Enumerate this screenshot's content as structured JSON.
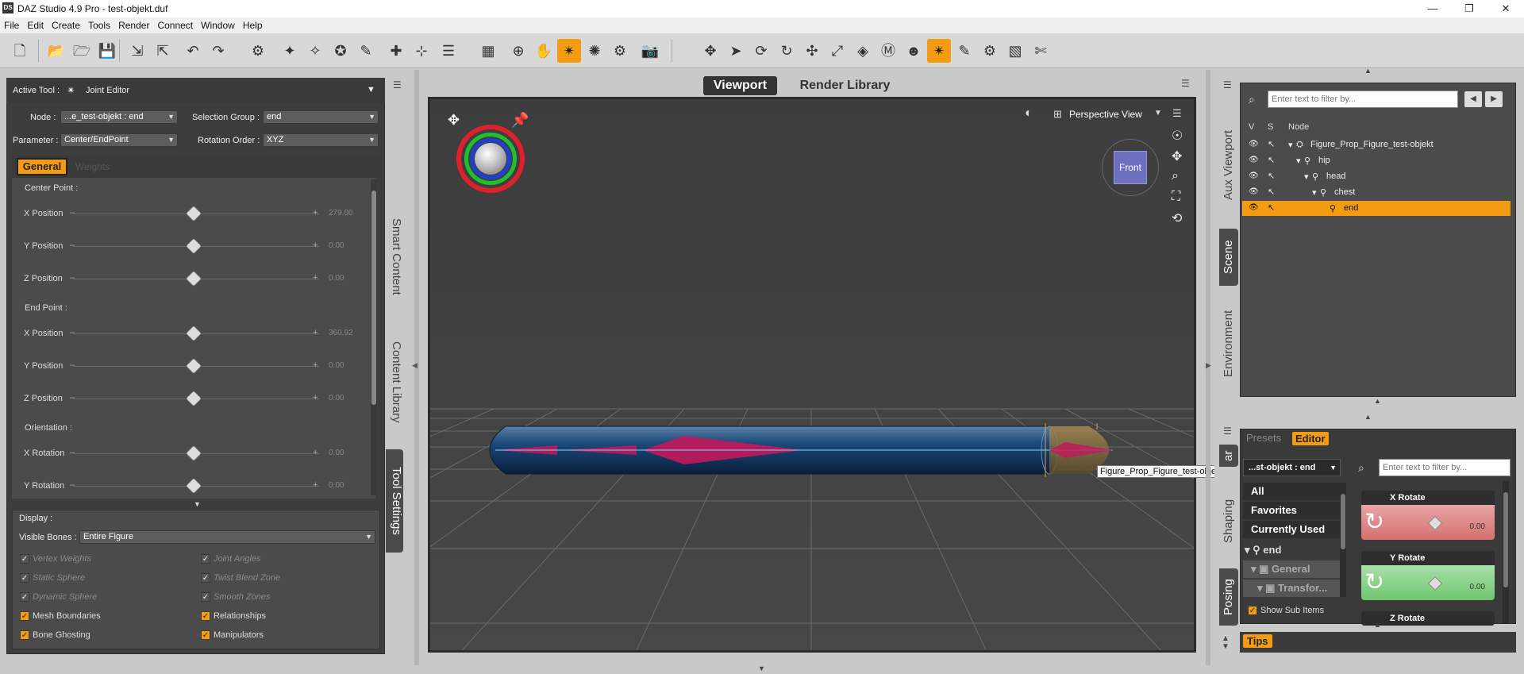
{
  "window": {
    "title": "DAZ Studio 4.9 Pro - test-objekt.duf",
    "app_icon": "DS"
  },
  "menu": [
    "File",
    "Edit",
    "Create",
    "Tools",
    "Render",
    "Connect",
    "Window",
    "Help"
  ],
  "tool_settings": {
    "active_tool_label": "Active Tool :",
    "active_tool": "Joint Editor",
    "node_label": "Node :",
    "node_value": "...e_test-objekt : end",
    "selection_group_label": "Selection Group :",
    "selection_group_value": "end",
    "parameter_label": "Parameter :",
    "parameter_value": "Center/EndPoint",
    "rotation_order_label": "Rotation Order :",
    "rotation_order_value": "XYZ",
    "tabs": [
      "General",
      "Weights"
    ],
    "center_point_label": "Center Point :",
    "end_point_label": "End Point :",
    "orientation_label": "Orientation :",
    "sliders": [
      {
        "label": "X Position",
        "value": "279.00"
      },
      {
        "label": "Y Position",
        "value": "0.00"
      },
      {
        "label": "Z Position",
        "value": "0.00"
      },
      {
        "label": "X Position",
        "value": "360.92"
      },
      {
        "label": "Y Position",
        "value": "0.00"
      },
      {
        "label": "Z Position",
        "value": "0.00"
      },
      {
        "label": "X Rotation",
        "value": "0.00"
      },
      {
        "label": "Y Rotation",
        "value": "0.00"
      }
    ],
    "display_label": "Display :",
    "visible_bones_label": "Visible Bones :",
    "visible_bones_value": "Entire Figure",
    "checkboxes_left": [
      {
        "label": "Vertex Weights",
        "checked": true,
        "disabled": true
      },
      {
        "label": "Static Sphere",
        "checked": true,
        "disabled": true
      },
      {
        "label": "Dynamic Sphere",
        "checked": true,
        "disabled": true
      },
      {
        "label": "Mesh Boundaries",
        "checked": true,
        "disabled": false
      },
      {
        "label": "Bone Ghosting",
        "checked": true,
        "disabled": false
      }
    ],
    "checkboxes_right": [
      {
        "label": "Joint Angles",
        "checked": true,
        "disabled": true
      },
      {
        "label": "Twist Blend Zone",
        "checked": true,
        "disabled": true
      },
      {
        "label": "Smooth Zones",
        "checked": true,
        "disabled": true
      },
      {
        "label": "Relationships",
        "checked": true,
        "disabled": false
      },
      {
        "label": "Manipulators",
        "checked": true,
        "disabled": false
      }
    ]
  },
  "left_side_tabs": [
    "Smart Content",
    "Content Library",
    "Tool Settings"
  ],
  "viewport": {
    "tabs": [
      "Viewport",
      "Render Library"
    ],
    "view_label": "Perspective View",
    "cube_label": "Front",
    "tooltip": "Figure_Prop_Figure_test-objekt : end"
  },
  "right_side_tabs_top": [
    "Aux Viewport",
    "Scene",
    "Environment"
  ],
  "right_side_tabs_bottom": [
    "Shaping",
    "Posing"
  ],
  "scene": {
    "filter_placeholder": "Enter text to filter by...",
    "columns": [
      "V",
      "S",
      "Node"
    ],
    "nodes": [
      {
        "name": "Figure_Prop_Figure_test-objekt",
        "depth": 0,
        "selected": false
      },
      {
        "name": "hip",
        "depth": 1,
        "selected": false
      },
      {
        "name": "head",
        "depth": 2,
        "selected": false
      },
      {
        "name": "chest",
        "depth": 3,
        "selected": false
      },
      {
        "name": "end",
        "depth": 4,
        "selected": true
      }
    ]
  },
  "parameters": {
    "tabs": [
      "Presets",
      "Editor"
    ],
    "node_value": "...st-objekt : end",
    "filter_placeholder": "Enter text to filter by...",
    "categories": [
      "All",
      "Favorites",
      "Currently Used"
    ],
    "tree": [
      "end",
      "General",
      "Transfor..."
    ],
    "show_sub_items": "Show Sub Items",
    "items": [
      {
        "label": "X Rotate",
        "value": "0.00",
        "color": "#e08b8b"
      },
      {
        "label": "Y Rotate",
        "value": "0.00",
        "color": "#8fd68f"
      },
      {
        "label": "Z Rotate",
        "value": "",
        "color": "#8b8be0"
      }
    ],
    "tips_label": "Tips"
  },
  "colors": {
    "accent": "#f39c12",
    "panel": "#4b4b4b",
    "viewport_bg": "#3f3f3f"
  }
}
